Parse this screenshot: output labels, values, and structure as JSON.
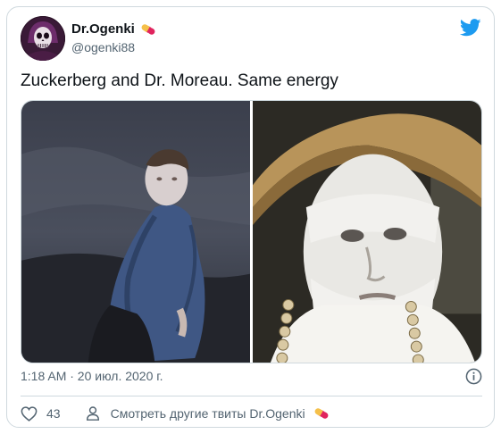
{
  "tweet": {
    "author": {
      "display_name": "Dr.Ogenki",
      "handle": "@ogenki88",
      "badge_icon": "pill-icon",
      "avatar_icon": "skull-avatar"
    },
    "text": "Zuckerberg and Dr. Moreau. Same energy",
    "media": [
      {
        "id": "left",
        "icon": "photo-man-blue-shirt"
      },
      {
        "id": "right",
        "icon": "photo-bandaged-face-hat"
      }
    ],
    "timestamp": "1:18 AM · 20 июл. 2020 г.",
    "likes": "43",
    "more_tweets_label": "Смотреть другие твиты Dr.Ogenki"
  },
  "colors": {
    "twitter_blue": "#1d9bf0",
    "secondary_text": "#536471",
    "border": "#cfd9de",
    "pill_red": "#e0245e"
  }
}
